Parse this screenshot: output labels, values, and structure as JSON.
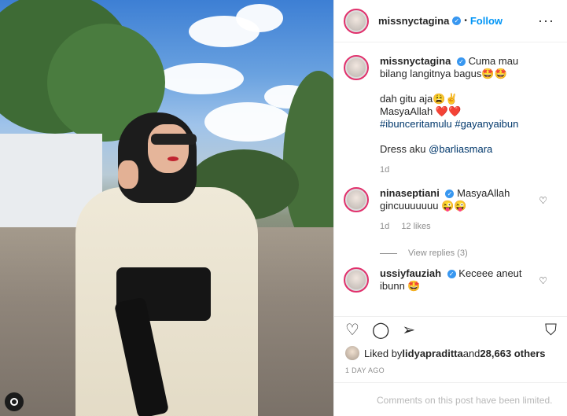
{
  "header": {
    "username": "missnyctagina",
    "separator": "•",
    "follow_label": "Follow",
    "more_label": "···"
  },
  "caption": {
    "username": "missnyctagina",
    "line1": "Cuma mau bilang langitnya bagus🤩🤩",
    "line2": "dah gitu aja😩✌",
    "line3": "MasyaAllah ❤️❤️",
    "hashtags": "#ibunceritamulu #gayanyaibun",
    "dress_prefix": "Dress aku ",
    "dress_mention": "@barliasmara",
    "age": "1d"
  },
  "comments": [
    {
      "username": "ninaseptiani",
      "text": "MasyaAllah gincuuuuuuu 😜😜",
      "age": "1d",
      "likes": "12 likes",
      "replies": "View replies (3)"
    },
    {
      "username": "ussiyfauziah",
      "text": "Keceee aneut ibunn 🤩"
    }
  ],
  "likes": {
    "prefix": "Liked by ",
    "user": "lidyapraditta",
    "middle": " and ",
    "count": "28,663 others"
  },
  "timestamp": "1 DAY AGO",
  "comments_limited": "Comments on this post have been limited.",
  "colors": {
    "link": "#0095f6",
    "tag": "#00376b",
    "story_ring": "#e1306c",
    "verified": "#3897f0"
  }
}
